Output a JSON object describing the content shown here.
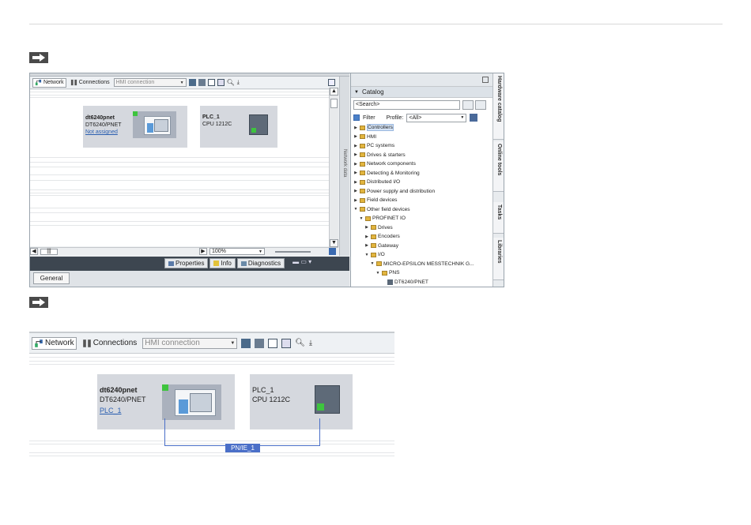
{
  "arrows": [
    "arrow-right-icon",
    "arrow-right-icon"
  ],
  "shot1": {
    "toolbar": {
      "network_label": "Network",
      "connections_label": "Connections",
      "connection_type": "HMI connection"
    },
    "devices": [
      {
        "name": "dt6240pnet",
        "type": "DT6240/PNET",
        "link": "Not assigned"
      },
      {
        "name": "PLC_1",
        "type": "CPU 1212C"
      }
    ],
    "zoom": "100%",
    "side_label": "Network data",
    "property_tabs": [
      "Properties",
      "Info",
      "Diagnostics"
    ],
    "general_tab": "General",
    "catalog": {
      "title": "Catalog",
      "search_placeholder": "<Search>",
      "filter_label": "Filter",
      "profile_label": "Profile:",
      "profile_value": "<All>",
      "tree": [
        {
          "label": "Controllers",
          "level": 0,
          "state": "collapsed",
          "selected": true
        },
        {
          "label": "HMI",
          "level": 0,
          "state": "collapsed"
        },
        {
          "label": "PC systems",
          "level": 0,
          "state": "collapsed"
        },
        {
          "label": "Drives & starters",
          "level": 0,
          "state": "collapsed"
        },
        {
          "label": "Network components",
          "level": 0,
          "state": "collapsed"
        },
        {
          "label": "Detecting & Monitoring",
          "level": 0,
          "state": "collapsed"
        },
        {
          "label": "Distributed I/O",
          "level": 0,
          "state": "collapsed"
        },
        {
          "label": "Power supply and distribution",
          "level": 0,
          "state": "collapsed"
        },
        {
          "label": "Field devices",
          "level": 0,
          "state": "collapsed"
        },
        {
          "label": "Other field devices",
          "level": 0,
          "state": "expanded"
        },
        {
          "label": "PROFINET IO",
          "level": 1,
          "state": "expanded"
        },
        {
          "label": "Drives",
          "level": 2,
          "state": "collapsed"
        },
        {
          "label": "Encoders",
          "level": 2,
          "state": "collapsed"
        },
        {
          "label": "Gateway",
          "level": 2,
          "state": "collapsed"
        },
        {
          "label": "I/O",
          "level": 2,
          "state": "expanded"
        },
        {
          "label": "MICRO-EPSILON MESSTECHNIK G...",
          "level": 3,
          "state": "expanded"
        },
        {
          "label": "PNS",
          "level": 4,
          "state": "expanded"
        },
        {
          "label": "DT6240/PNET",
          "level": 5,
          "state": "device"
        }
      ]
    },
    "rail_tabs": [
      "Hardware catalog",
      "Online tools",
      "Tasks",
      "Libraries"
    ]
  },
  "shot2": {
    "toolbar": {
      "network_label": "Network",
      "connections_label": "Connections",
      "connection_type": "HMI connection"
    },
    "devices": [
      {
        "name": "dt6240pnet",
        "type": "DT6240/PNET",
        "link": "PLC_1"
      },
      {
        "name": "PLC_1",
        "type": "CPU 1212C"
      }
    ],
    "subnet": "PN/IE_1"
  },
  "colors": {
    "accent": "#4a6fc8",
    "device_bg": "#d5d8de",
    "status_green": "#3ec43e",
    "folder": "#e2b53e"
  }
}
